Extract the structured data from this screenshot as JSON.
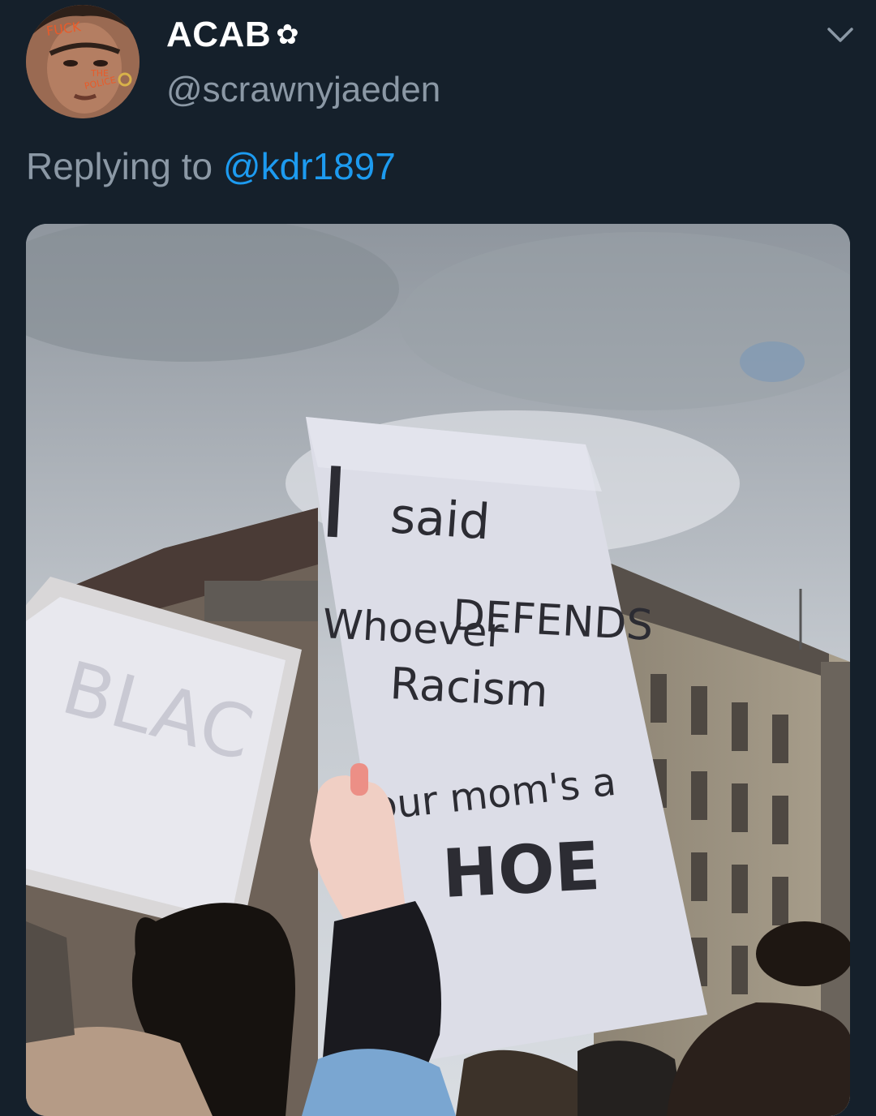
{
  "tweet": {
    "author": {
      "display_name": "ACAB",
      "name_emoji": "✿",
      "handle": "@scrawnyjaeden",
      "avatar_face_text": [
        "FUCK",
        "THE",
        "POLICE"
      ]
    },
    "reply": {
      "prefix": "Replying to ",
      "mention": "@kdr1897"
    },
    "menu_icon": "chevron-down-icon",
    "media": {
      "sign_text": {
        "line1": "I",
        "line2": "said",
        "line3a": "Whoever",
        "line3b": "DEFENDS",
        "line4": "Racism",
        "line5": "our mom's a",
        "line6": "HOE"
      }
    }
  },
  "colors": {
    "background": "#15202b",
    "secondary_text": "#8b98a5",
    "link": "#1d9bf0"
  }
}
